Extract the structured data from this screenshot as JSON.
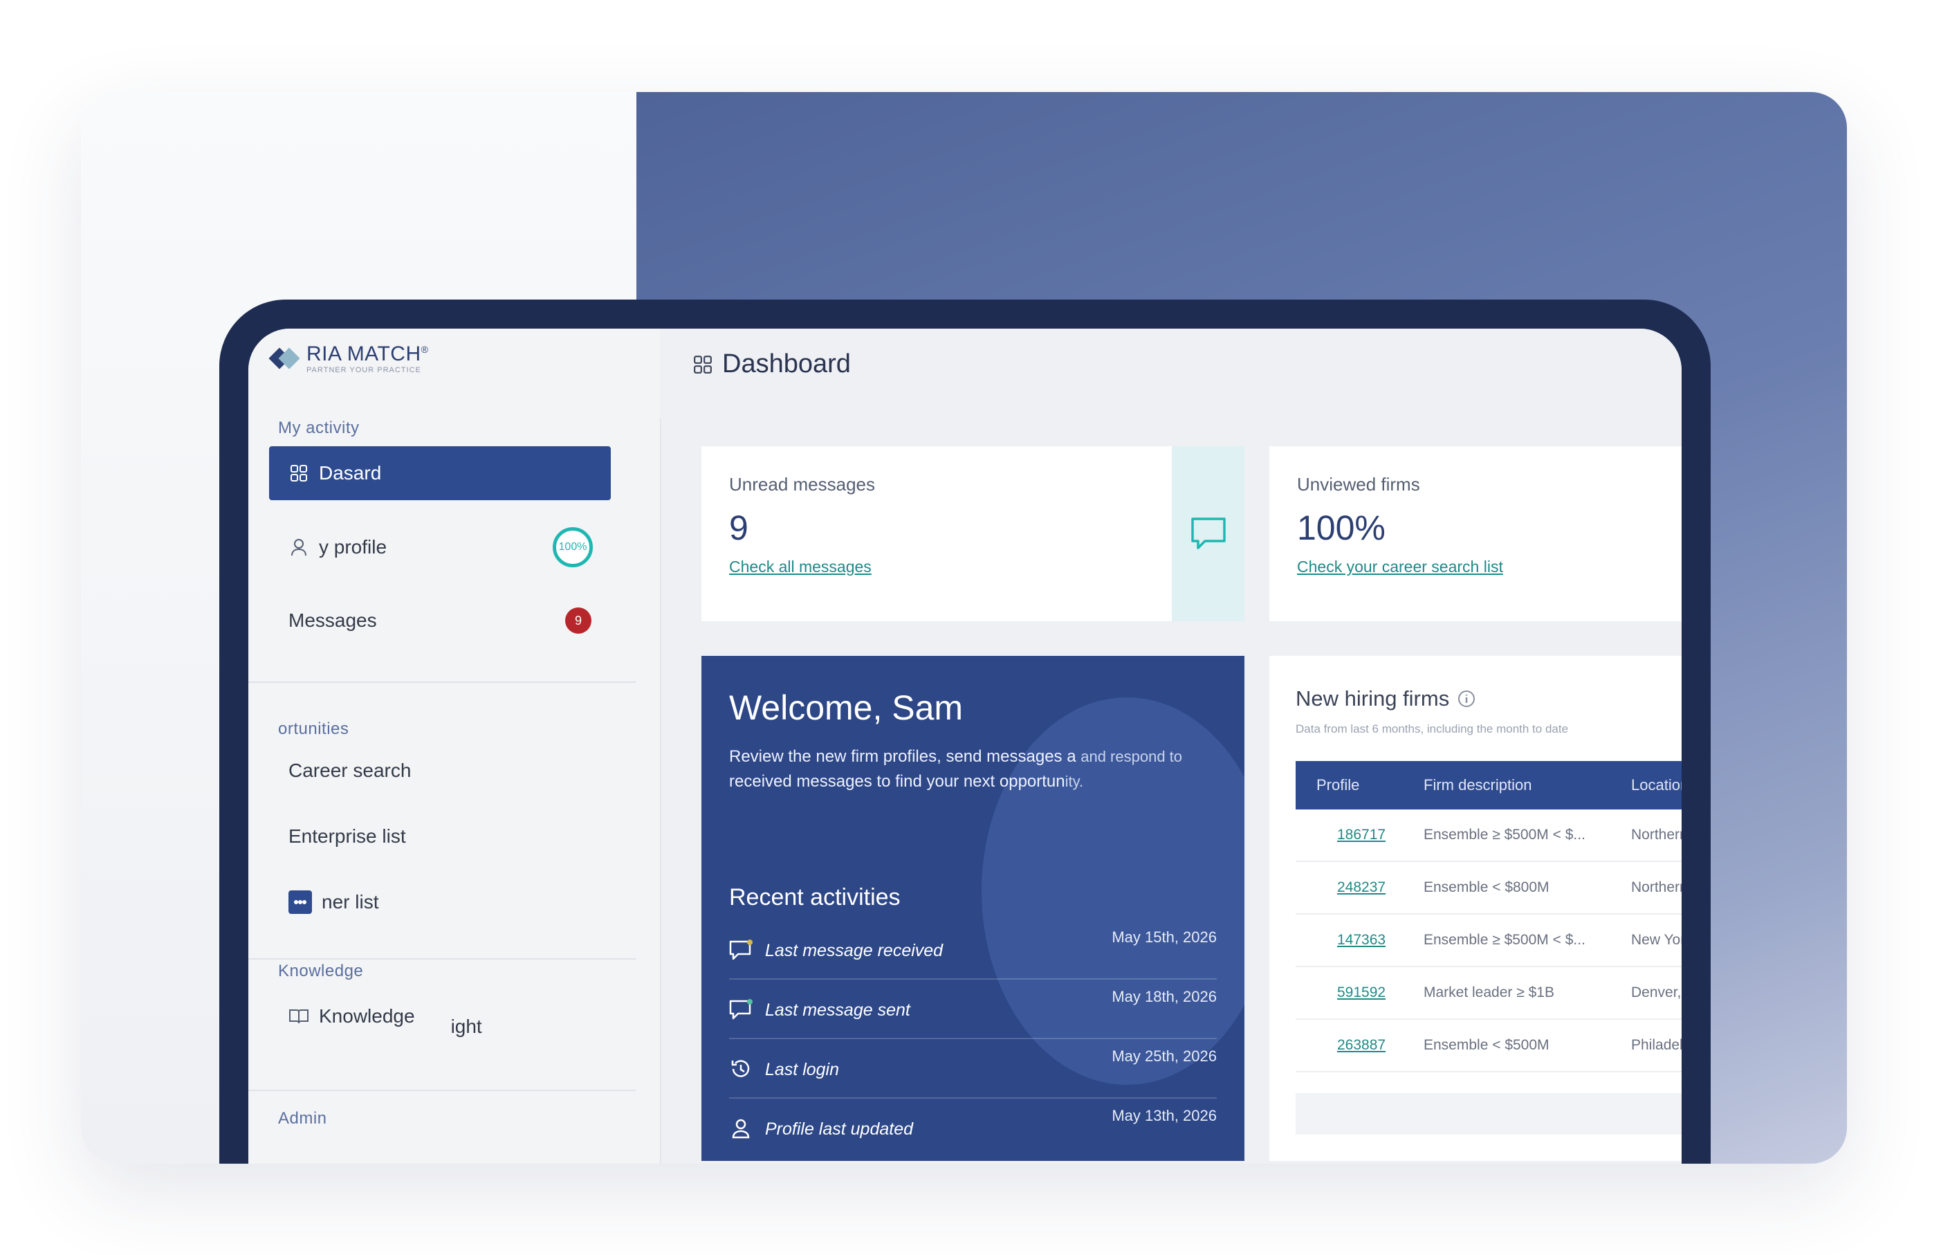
{
  "app": {
    "brand_name": "RIA MATCH",
    "brand_mark": "®",
    "brand_tagline": "PARTNER YOUR PRACTICE"
  },
  "header": {
    "title": "Dashboard",
    "icon": "grid-icon"
  },
  "sidebar": {
    "sections": [
      {
        "label": "My activity"
      },
      {
        "label": "ortunities"
      },
      {
        "label": "Knowledge"
      },
      {
        "label": "Admin"
      }
    ],
    "items": [
      {
        "label": "Dasard",
        "icon": "grid-icon",
        "active": true
      },
      {
        "label": "y profile",
        "icon": "user-icon",
        "badge": "100%"
      },
      {
        "label": "Messages",
        "badge": "9"
      },
      {
        "label": "Career search"
      },
      {
        "label": "Enterprise list"
      },
      {
        "label": "ner list",
        "icon": "list-icon"
      },
      {
        "label": "Knowledge",
        "label_tail": "ight",
        "icon": "book-icon"
      }
    ]
  },
  "unread": {
    "label": "Unread messages",
    "value": "9",
    "link": "Check all messages"
  },
  "unviewed": {
    "label": "Unviewed firms",
    "value": "100%",
    "link": "Check your career search list"
  },
  "welcome": {
    "title": "Welcome, Sam",
    "text_line1": "Review the new firm profiles, send messages a",
    "text_line2": "received messages to find your next opportun",
    "text_tail1": "and respond to",
    "text_tail2": "ity.",
    "recent_title": "Recent activities",
    "activities": [
      {
        "label": "Last message received",
        "date": "May 15th, 2026",
        "icon": "chat-icon"
      },
      {
        "label": "Last message sent",
        "date": "May 18th, 2026",
        "icon": "chat-icon"
      },
      {
        "label": "Last login",
        "date": "May 25th, 2026",
        "icon": "history-icon"
      },
      {
        "label": "Profile last updated",
        "date": "May 13th, 2026",
        "icon": "user-icon"
      }
    ]
  },
  "hiring": {
    "title": "New hiring firms",
    "subtitle": "Data from last 6 months, including the month to date",
    "columns": [
      "Profile",
      "Firm description",
      "Location"
    ],
    "rows": [
      [
        "186717",
        "Ensemble ≥ $500M < $...",
        "Northern W"
      ],
      [
        "248237",
        "Ensemble < $800M",
        "Northern Ne"
      ],
      [
        "147363",
        "Ensemble ≥ $500M < $...",
        "New York C"
      ],
      [
        "591592",
        "Market leader ≥ $1B",
        "Denver, CO"
      ],
      [
        "263887",
        "Ensemble < $500M",
        "Philadelphia"
      ]
    ]
  },
  "colors": {
    "accent": "#2f4b8f",
    "teal": "#1fb7b2",
    "badge_red": "#b7262b",
    "frame": "#1e2c51"
  }
}
